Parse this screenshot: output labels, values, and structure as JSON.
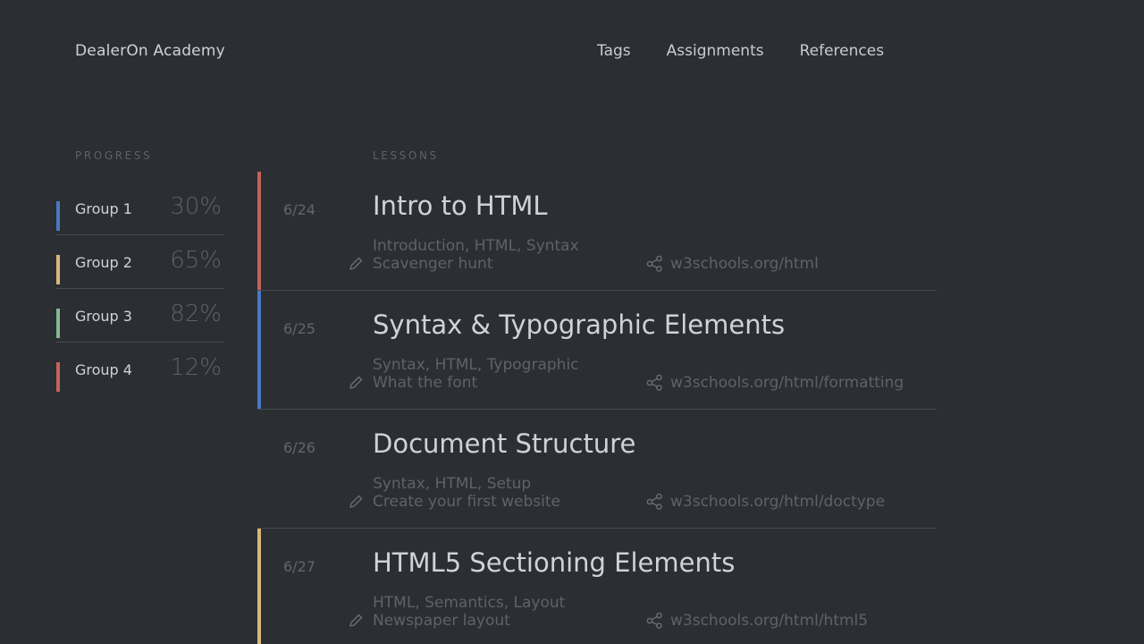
{
  "header": {
    "brand": "DealerOn Academy",
    "nav": [
      "Tags",
      "Assignments",
      "References"
    ]
  },
  "progress": {
    "heading": "PROGRESS",
    "groups": [
      {
        "name": "Group 1",
        "percent": "30%",
        "color": "#4a78c2"
      },
      {
        "name": "Group 2",
        "percent": "65%",
        "color": "#d9b77a"
      },
      {
        "name": "Group 3",
        "percent": "82%",
        "color": "#86b894"
      },
      {
        "name": "Group 4",
        "percent": "12%",
        "color": "#c36458"
      }
    ]
  },
  "lessons": {
    "heading": "LESSONS",
    "items": [
      {
        "date": "6/24",
        "title": "Intro to HTML",
        "tags": "Introduction, HTML, Syntax",
        "assignment": "Scavenger hunt",
        "reference": "w3schools.org/html",
        "color": "#c36458"
      },
      {
        "date": "6/25",
        "title": "Syntax & Typographic Elements",
        "tags": "Syntax, HTML, Typographic",
        "assignment": "What the font",
        "reference": "w3schools.org/html/formatting",
        "color": "#4a78c2"
      },
      {
        "date": "6/26",
        "title": "Document Structure",
        "tags": "Syntax, HTML, Setup",
        "assignment": "Create your first website",
        "reference": "w3schools.org/html/doctype",
        "color": ""
      },
      {
        "date": "6/27",
        "title": "HTML5 Sectioning Elements",
        "tags": "HTML, Semantics, Layout",
        "assignment": "Newspaper layout",
        "reference": "w3schools.org/html/html5",
        "color": "#d9b77a"
      }
    ]
  },
  "icons": {
    "assignment": "pencil-icon",
    "reference": "share-icon"
  }
}
